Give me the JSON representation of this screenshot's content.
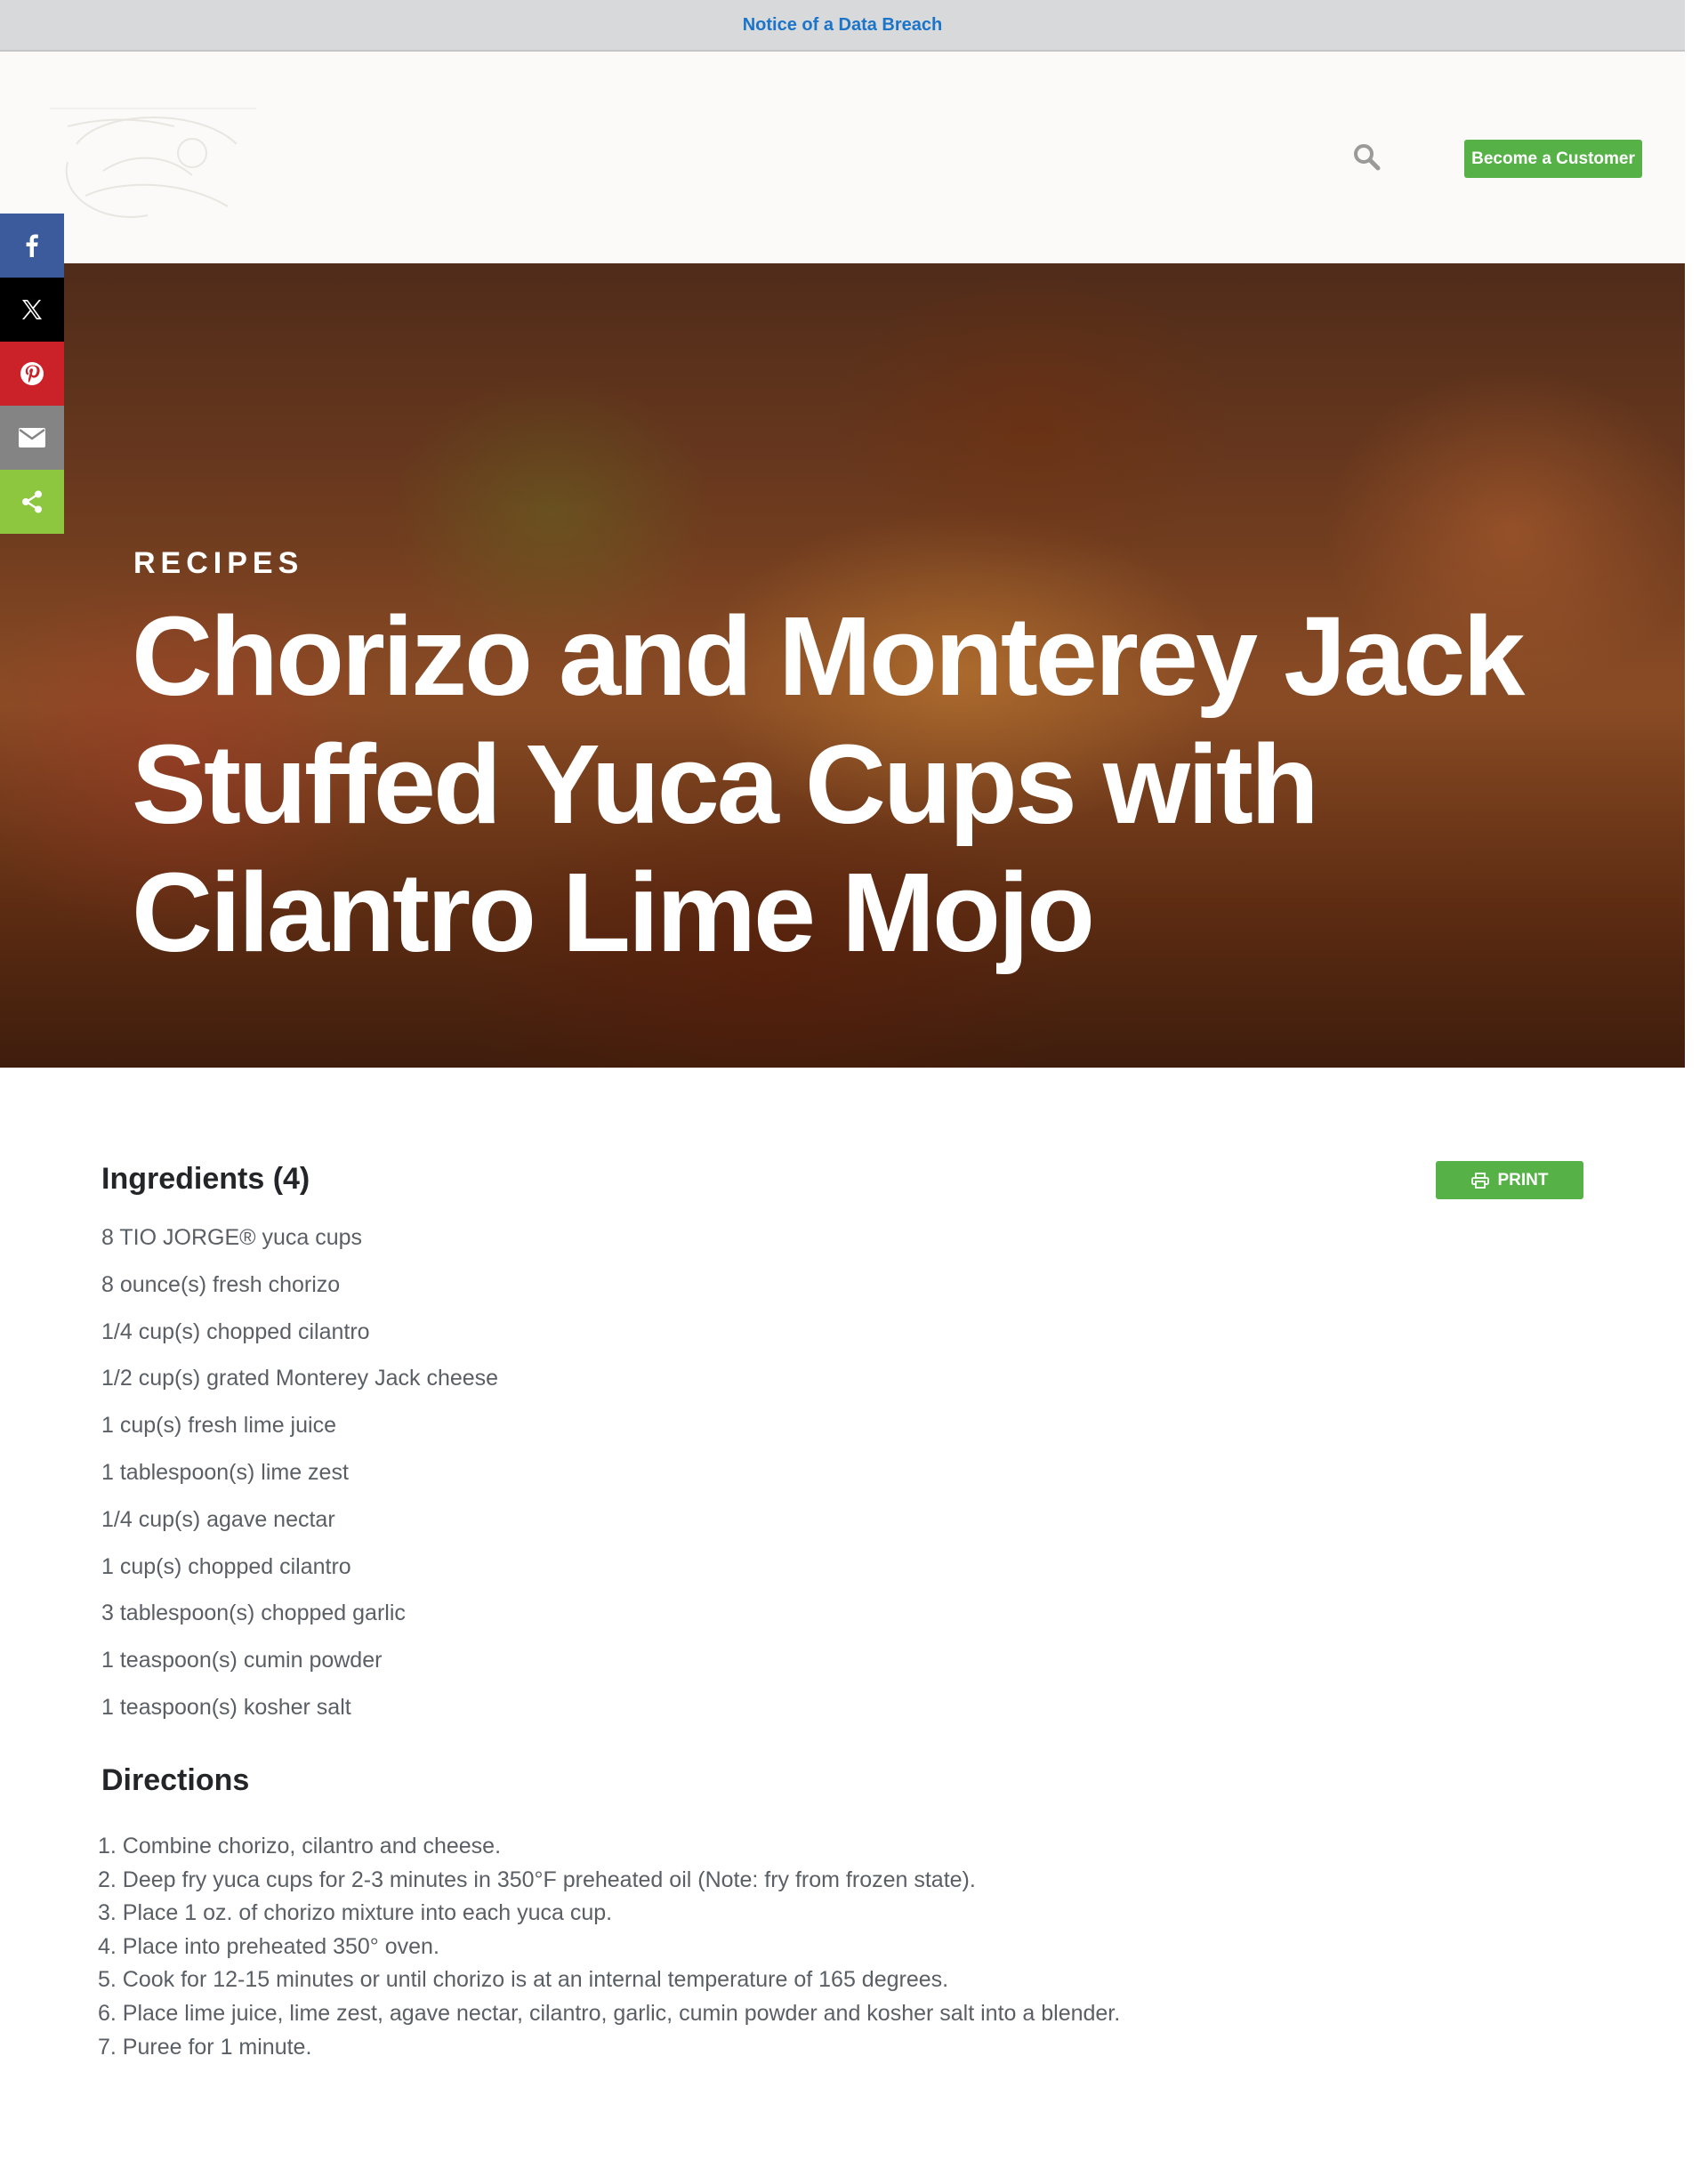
{
  "notice": {
    "text": "Notice of a Data Breach"
  },
  "header": {
    "logo_alt": "Sysco Fiesta Salsica",
    "cta_label": "Become a Customer",
    "search_icon": "search-icon"
  },
  "share": {
    "items": [
      {
        "icon": "facebook-icon"
      },
      {
        "icon": "x-icon"
      },
      {
        "icon": "pinterest-icon"
      },
      {
        "icon": "email-icon"
      },
      {
        "icon": "share-icon"
      }
    ],
    "colors": {
      "facebook": "#3b5b9c",
      "x": "#000000",
      "pinterest": "#cb2128",
      "email": "#848484",
      "more": "#8dc63f"
    }
  },
  "hero": {
    "eyebrow": "RECIPES",
    "title": "Chorizo and Monterey Jack Stuffed Yuca Cups with Cilantro Lime Mojo"
  },
  "ingredients": {
    "title": "Ingredients (4)",
    "print_label": "PRINT",
    "items": [
      "8 TIO JORGE® yuca cups",
      "8 ounce(s) fresh chorizo",
      "1/4 cup(s) chopped cilantro",
      "1/2 cup(s) grated Monterey Jack cheese",
      "1 cup(s) fresh lime juice",
      "1 tablespoon(s) lime zest",
      "1/4 cup(s) agave nectar",
      "1 cup(s) chopped cilantro",
      "3 tablespoon(s) chopped garlic",
      "1 teaspoon(s) cumin powder",
      "1 teaspoon(s) kosher salt"
    ]
  },
  "directions": {
    "title": "Directions",
    "steps": [
      "1. Combine chorizo, cilantro and cheese.",
      "2. Deep fry yuca cups for 2-3 minutes in 350°F preheated oil (Note: fry from frozen state).",
      "3. Place 1 oz. of chorizo mixture into each yuca cup.",
      "4. Place into preheated 350° oven.",
      "5. Cook for 12-15 minutes or until chorizo is at an internal temperature of 165 degrees.",
      "6. Place lime juice, lime zest, agave nectar, cilantro, garlic, cumin powder and kosher salt into a blender.",
      "7. Puree for 1 minute."
    ]
  },
  "theme": {
    "accent": "#56b147",
    "link": "#1a74c9",
    "text": "#5a5f66",
    "heading": "#232528"
  }
}
